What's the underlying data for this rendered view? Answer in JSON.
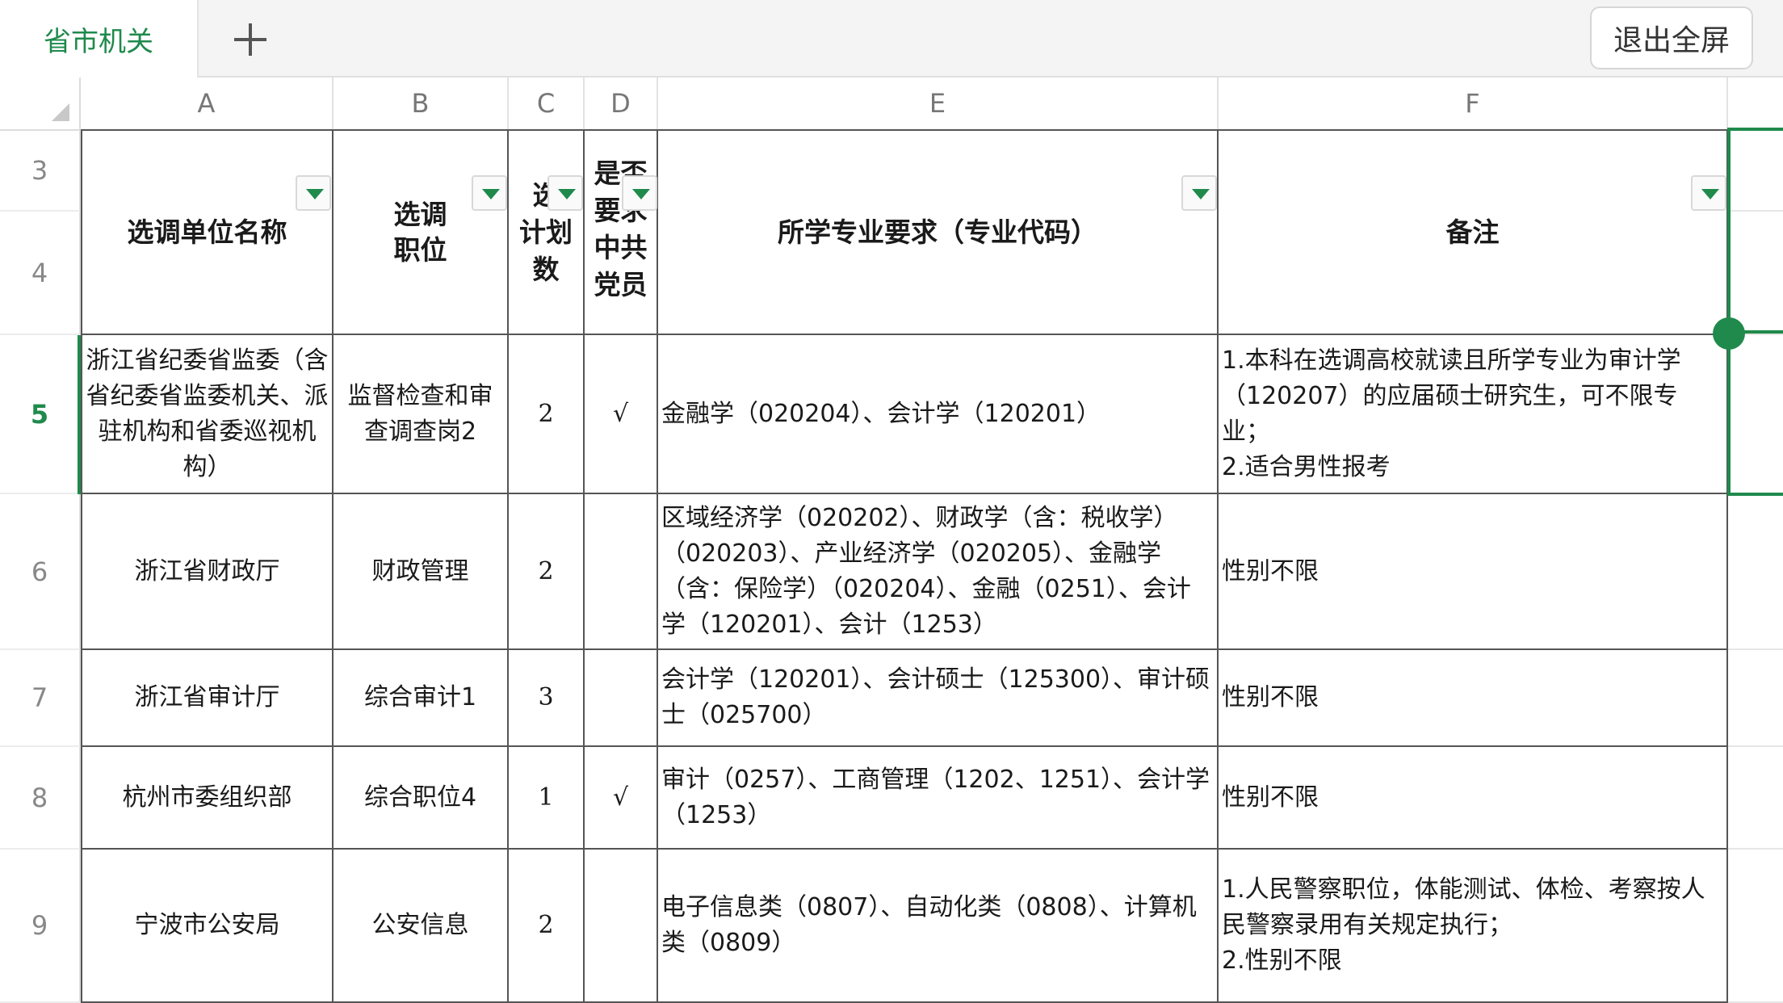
{
  "tabbar": {
    "sheet_name": "省市机关",
    "exit_fullscreen": "退出全屏"
  },
  "columns": [
    "A",
    "B",
    "C",
    "D",
    "E",
    "F"
  ],
  "rows": [
    "3",
    "4",
    "5",
    "6",
    "7",
    "8",
    "9"
  ],
  "header": {
    "unit": "选调单位名称",
    "position": "选调\n职位",
    "plan": "选\n计划\n数",
    "party": "是否\n要求\n中共\n党员",
    "major": "所学专业要求（专业代码）",
    "note": "备注"
  },
  "records": [
    {
      "unit": "浙江省纪委省监委（含省纪委省监委机关、派驻机构和省委巡视机构）",
      "position": "监督检查和审查调查岗2",
      "plan": "2",
      "party": "√",
      "major": "金融学（020204）、会计学（120201）",
      "note": "1.本科在选调高校就读且所学专业为审计学（120207）的应届硕士研究生，可不限专业；\n2.适合男性报考"
    },
    {
      "unit": "浙江省财政厅",
      "position": "财政管理",
      "plan": "2",
      "party": "",
      "major": "区域经济学（020202）、财政学（含：税收学）（020203）、产业经济学（020205）、金融学（含：保险学）（020204）、金融（0251）、会计学（120201）、会计（1253）",
      "note": "性别不限"
    },
    {
      "unit": "浙江省审计厅",
      "position": "综合审计1",
      "plan": "3",
      "party": "",
      "major": "会计学（120201）、会计硕士（125300）、审计硕士（025700）",
      "note": "性别不限"
    },
    {
      "unit": "杭州市委组织部",
      "position": "综合职位4",
      "plan": "1",
      "party": "√",
      "major": "审计（0257）、工商管理（1202、1251）、会计学（1253）",
      "note": "性别不限"
    },
    {
      "unit": "宁波市公安局",
      "position": "公安信息",
      "plan": "2",
      "party": "",
      "major": "电子信息类（0807）、自动化类（0808）、计算机类（0809）",
      "note": "1.人民警察职位，体能测试、体检、考察按人民警察录用有关规定执行；\n2.性别不限"
    }
  ],
  "colors": {
    "accent": "#1f8a4c",
    "grid": "#555555"
  },
  "icons": {
    "add_tab": "plus-icon",
    "filter": "filter-dropdown-icon",
    "corner": "select-all-triangle-icon"
  }
}
